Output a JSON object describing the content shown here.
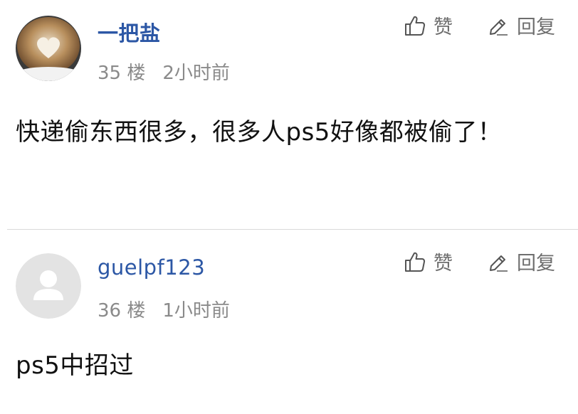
{
  "comments": [
    {
      "username": "一把盐",
      "floor": "35 楼",
      "time": "2小时前",
      "like_label": "赞",
      "reply_label": "回复",
      "body": "快递偷东西很多，很多人ps5好像都被偷了！",
      "avatar_icon": "latte-art-heart"
    },
    {
      "username": "guelpf123",
      "floor": "36 楼",
      "time": "1小时前",
      "like_label": "赞",
      "reply_label": "回复",
      "body": "ps5中招过",
      "avatar_icon": "default-user-icon"
    }
  ],
  "colors": {
    "username": "#2c57a5",
    "meta": "#8a8a8a",
    "divider": "#d9d9d9"
  }
}
